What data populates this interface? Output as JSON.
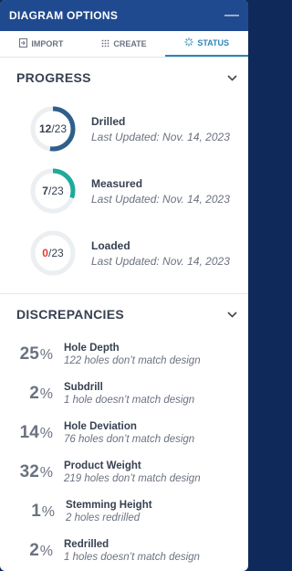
{
  "header": {
    "title": "DIAGRAM OPTIONS",
    "minimize": "—"
  },
  "tabs": [
    {
      "label": "IMPORT",
      "icon": "import-icon"
    },
    {
      "label": "CREATE",
      "icon": "create-icon"
    },
    {
      "label": "STATUS",
      "icon": "status-icon"
    }
  ],
  "progress": {
    "title": "PROGRESS",
    "items": [
      {
        "count": "12",
        "total": "23",
        "fraction": 0.5217,
        "color": "#2f5f8a",
        "label": "Drilled",
        "updated": "Last Updated: Nov. 14, 2023"
      },
      {
        "count": "7",
        "total": "23",
        "fraction": 0.3043,
        "color": "#1faa9a",
        "label": "Measured",
        "updated": "Last Updated: Nov. 14, 2023"
      },
      {
        "count": "0",
        "total": "23",
        "fraction": 0.0,
        "color": "#e53935",
        "label": "Loaded",
        "updated": "Last Updated: Nov. 14, 2023"
      }
    ]
  },
  "discrepancies": {
    "title": "DISCREPANCIES",
    "items": [
      {
        "pct": "25",
        "label": "Hole Depth",
        "detail": "122 holes don’t match design"
      },
      {
        "pct": "2",
        "label": "Subdrill",
        "detail": "1 hole doesn’t match design"
      },
      {
        "pct": "14",
        "label": "Hole Deviation",
        "detail": "76 holes don’t match design"
      },
      {
        "pct": "32",
        "label": "Product Weight",
        "detail": "219 holes don’t match design"
      },
      {
        "pct": "1",
        "label": "Stemming Height",
        "detail": "2 holes redrilled"
      },
      {
        "pct": "2",
        "label": "Redrilled",
        "detail": "1 holes doesn’t match design"
      }
    ]
  },
  "colors": {
    "header": "#1f4a8f",
    "accent": "#2d86b8",
    "track": "#eceff1"
  }
}
